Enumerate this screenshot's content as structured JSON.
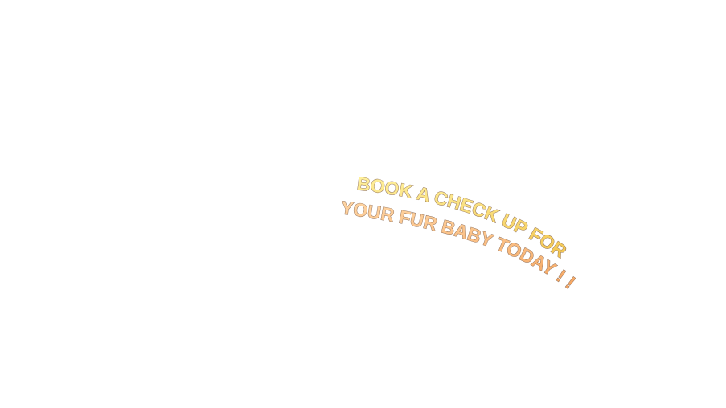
{
  "banner": {
    "line1": "BOOK A CHECK UP FOR",
    "line2": "YOUR FUR BABY TODAY ! !"
  },
  "colors": {
    "background": "#ffffff",
    "line1_fill_top": "#fff2a0",
    "line1_fill_bottom": "#f2c24a",
    "line2_fill_top": "#ffd7a6",
    "line2_fill_bottom": "#f4a25c",
    "outline": "#8a6a55"
  }
}
